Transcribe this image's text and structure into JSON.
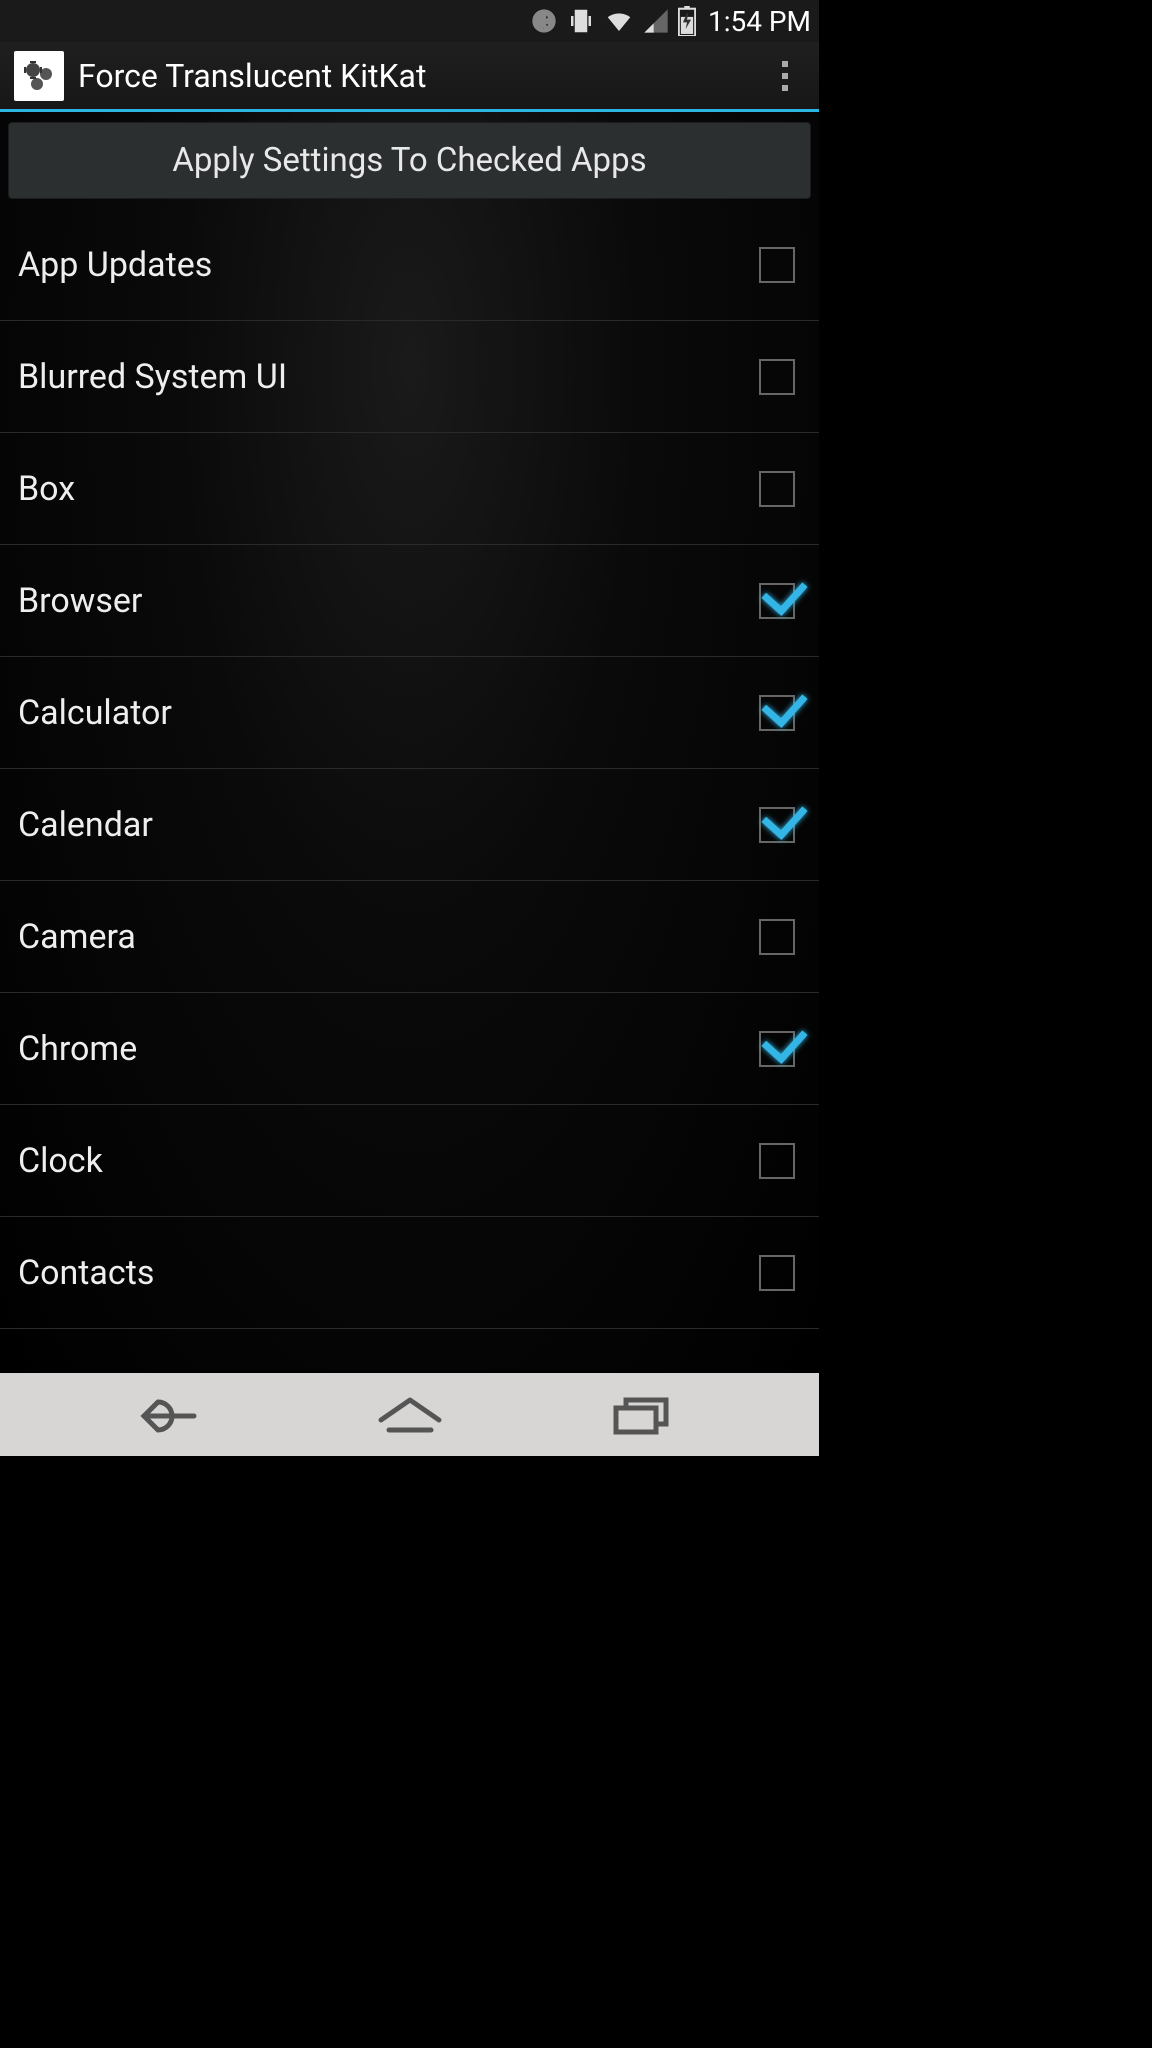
{
  "status": {
    "time": "1:54 PM"
  },
  "header": {
    "title": "Force Translucent KitKat"
  },
  "apply_button_label": "Apply Settings To Checked Apps",
  "apps": [
    {
      "name": "App Updates",
      "checked": false
    },
    {
      "name": "Blurred System UI",
      "checked": false
    },
    {
      "name": "Box",
      "checked": false
    },
    {
      "name": "Browser",
      "checked": true
    },
    {
      "name": "Calculator",
      "checked": true
    },
    {
      "name": "Calendar",
      "checked": true
    },
    {
      "name": "Camera",
      "checked": false
    },
    {
      "name": "Chrome",
      "checked": true
    },
    {
      "name": "Clock",
      "checked": false
    },
    {
      "name": "Contacts",
      "checked": false
    }
  ]
}
